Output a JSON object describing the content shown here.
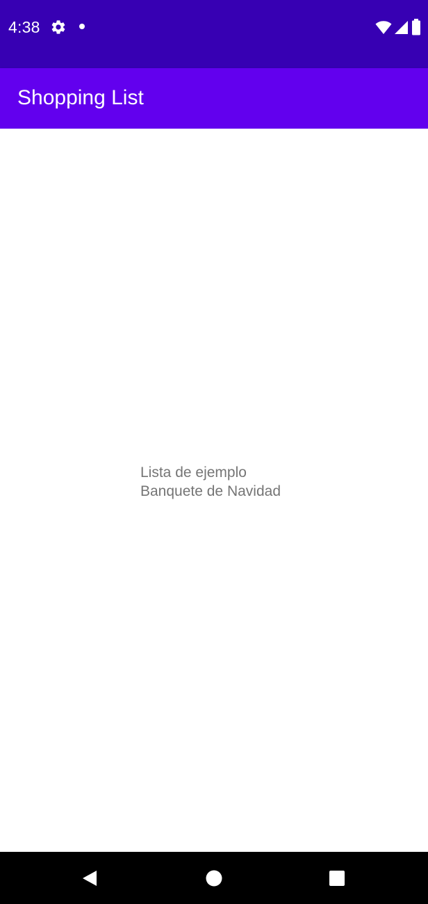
{
  "status_bar": {
    "time": "4:38",
    "icons": [
      "gear-icon",
      "notification-dot-icon",
      "wifi-icon",
      "cell-signal-icon",
      "battery-icon"
    ]
  },
  "app_bar": {
    "title": "Shopping List"
  },
  "list": {
    "items": [
      {
        "title": "Lista de ejemplo",
        "subtitle": "Banquete de Navidad"
      }
    ]
  },
  "nav_bar": {
    "buttons": [
      "back-icon",
      "home-icon",
      "recents-icon"
    ]
  },
  "colors": {
    "status_bar": "#3700b3",
    "app_bar": "#6200ee",
    "list_text": "#757575",
    "nav_bar": "#000000"
  }
}
